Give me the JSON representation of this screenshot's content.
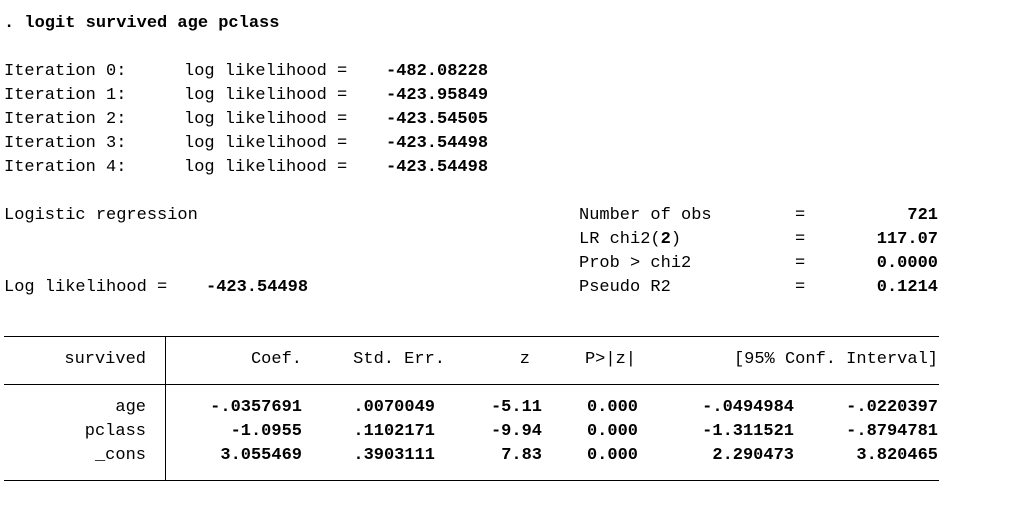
{
  "command": ". logit survived age pclass",
  "iterations": [
    {
      "label": "Iteration 0:",
      "text": "log likelihood =",
      "value": "-482.08228"
    },
    {
      "label": "Iteration 1:",
      "text": "log likelihood =",
      "value": "-423.95849"
    },
    {
      "label": "Iteration 2:",
      "text": "log likelihood =",
      "value": "-423.54505"
    },
    {
      "label": "Iteration 3:",
      "text": "log likelihood =",
      "value": "-423.54498"
    },
    {
      "label": "Iteration 4:",
      "text": "log likelihood =",
      "value": "-423.54498"
    }
  ],
  "model_title": "Logistic regression",
  "log_likelihood": {
    "label": "Log likelihood =",
    "value": "-423.54498"
  },
  "stats": [
    {
      "label": "Number of obs",
      "eq": "=",
      "value": "721"
    },
    {
      "label_pre": "LR chi2(",
      "label_df": "2",
      "label_post": ")",
      "eq": "=",
      "value": "117.07"
    },
    {
      "label": "Prob > chi2",
      "eq": "=",
      "value": "0.0000"
    },
    {
      "label": "Pseudo R2",
      "eq": "=",
      "value": "0.1214"
    }
  ],
  "table": {
    "depvar": "survived",
    "headers": {
      "coef": "Coef.",
      "se": "Std. Err.",
      "z": "z",
      "p": "P>|z|",
      "ci": "[95% Conf. Interval]"
    },
    "rows": [
      {
        "var": "age",
        "coef": "-.0357691",
        "se": ".0070049",
        "z": "-5.11",
        "p": "0.000",
        "lo": "-.0494984",
        "hi": "-.0220397"
      },
      {
        "var": "pclass",
        "coef": "-1.0955",
        "se": ".1102171",
        "z": "-9.94",
        "p": "0.000",
        "lo": "-1.311521",
        "hi": "-.8794781"
      },
      {
        "var": "_cons",
        "coef": "3.055469",
        "se": ".3903111",
        "z": "7.83",
        "p": "0.000",
        "lo": "2.290473",
        "hi": "3.820465"
      }
    ]
  }
}
